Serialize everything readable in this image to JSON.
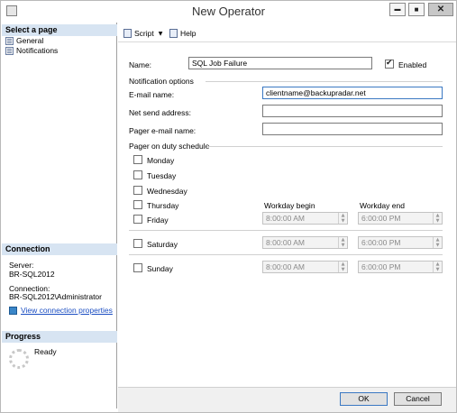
{
  "window": {
    "title": "New Operator"
  },
  "left": {
    "select_header": "Select a page",
    "nav": [
      {
        "label": "General"
      },
      {
        "label": "Notifications"
      }
    ],
    "connection_header": "Connection",
    "server_label": "Server:",
    "server_value": "BR-SQL2012",
    "connection_label": "Connection:",
    "connection_value": "BR-SQL2012\\Administrator",
    "view_props_link": "View connection properties",
    "progress_header": "Progress",
    "progress_status": "Ready"
  },
  "toolbar": {
    "script_label": "Script",
    "help_label": "Help",
    "dropdown_glyph": "▼"
  },
  "form": {
    "name_label": "Name:",
    "name_value": "SQL Job Failure",
    "enabled_label": "Enabled",
    "enabled_checked": true,
    "notification_section": "Notification options",
    "email_label": "E-mail name:",
    "email_value": "clientname@backupradar.net",
    "netsend_label": "Net send address:",
    "netsend_value": "",
    "pager_label": "Pager e-mail name:",
    "pager_value": "",
    "schedule_section": "Pager on duty schedule",
    "days": [
      {
        "label": "Monday"
      },
      {
        "label": "Tuesday"
      },
      {
        "label": "Wednesday"
      },
      {
        "label": "Thursday"
      },
      {
        "label": "Friday"
      }
    ],
    "saturday_label": "Saturday",
    "sunday_label": "Sunday",
    "workday_begin_label": "Workday begin",
    "workday_end_label": "Workday end",
    "weekday_begin": "8:00:00 AM",
    "weekday_end": "6:00:00 PM",
    "saturday_begin": "8:00:00 AM",
    "saturday_end": "6:00:00 PM",
    "sunday_begin": "8:00:00 AM",
    "sunday_end": "6:00:00 PM"
  },
  "buttons": {
    "ok_label": "OK",
    "cancel_label": "Cancel"
  },
  "window_controls": {
    "min": "▬",
    "max": "■",
    "close": "✕"
  }
}
